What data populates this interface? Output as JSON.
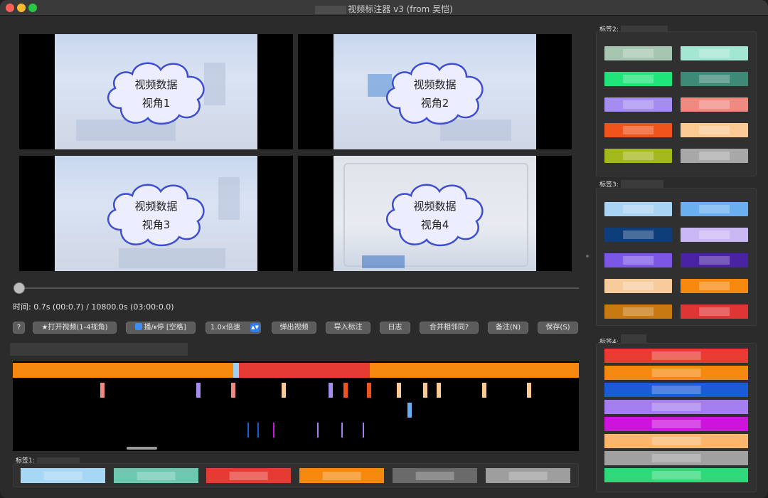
{
  "window": {
    "title": "视频标注器 v3 (from 吴恺)"
  },
  "videos": [
    {
      "line1": "视频数据",
      "line2": "视角1"
    },
    {
      "line1": "视频数据",
      "line2": "视角2"
    },
    {
      "line1": "视频数据",
      "line2": "视角3"
    },
    {
      "line1": "视频数据",
      "line2": "视角4"
    }
  ],
  "playback": {
    "time_text": "时间: 0.7s (00:0.7) / 10800.0s (03:00:0.0)"
  },
  "toolbar": {
    "help": "?",
    "open_video": "★打开视频(1-4视角)",
    "play_pause": "播/⏸停 [空格]",
    "speed": "1.0x倍速",
    "popout_video": "弹出视频",
    "import_labels": "导入标注",
    "log": "日志",
    "merge_adjacent": "合并相邻同?",
    "note": "备注(N)",
    "save": "保存(S)"
  },
  "groups": {
    "tag1_label": "标签1:",
    "tag2_label": "标签2:",
    "tag3_label": "标签3:",
    "tag4_label": "标签4:"
  },
  "colors": {
    "tag2": [
      "#a7c6b2",
      "#a3e6d2",
      "#1fe57a",
      "#3f8a76",
      "#a48cf0",
      "#ee8a80",
      "#f0531b",
      "#fbc994",
      "#a3b81c",
      "#a8a8a8"
    ],
    "tag3": [
      "#a9d4f4",
      "#6aaff0",
      "#0d3e7a",
      "#c9b7f4",
      "#7c57e6",
      "#4a23a3",
      "#f7cb9c",
      "#f6880e",
      "#c87912",
      "#e03535"
    ],
    "tag4": [
      "#ea3b32",
      "#f5880e",
      "#1a5cd8",
      "#a47ef0",
      "#cc14dc",
      "#fbb66c",
      "#a1a1a1",
      "#2fd979"
    ],
    "tag1": [
      "#a6d7f5",
      "#6cc9b0",
      "#e63b33",
      "#f6880e",
      "#6a6a6a",
      "#9e9e9e"
    ],
    "timeline_segments": [
      "#f5880e",
      "#9fd1ee",
      "#e63b33",
      "#f5880e"
    ]
  }
}
